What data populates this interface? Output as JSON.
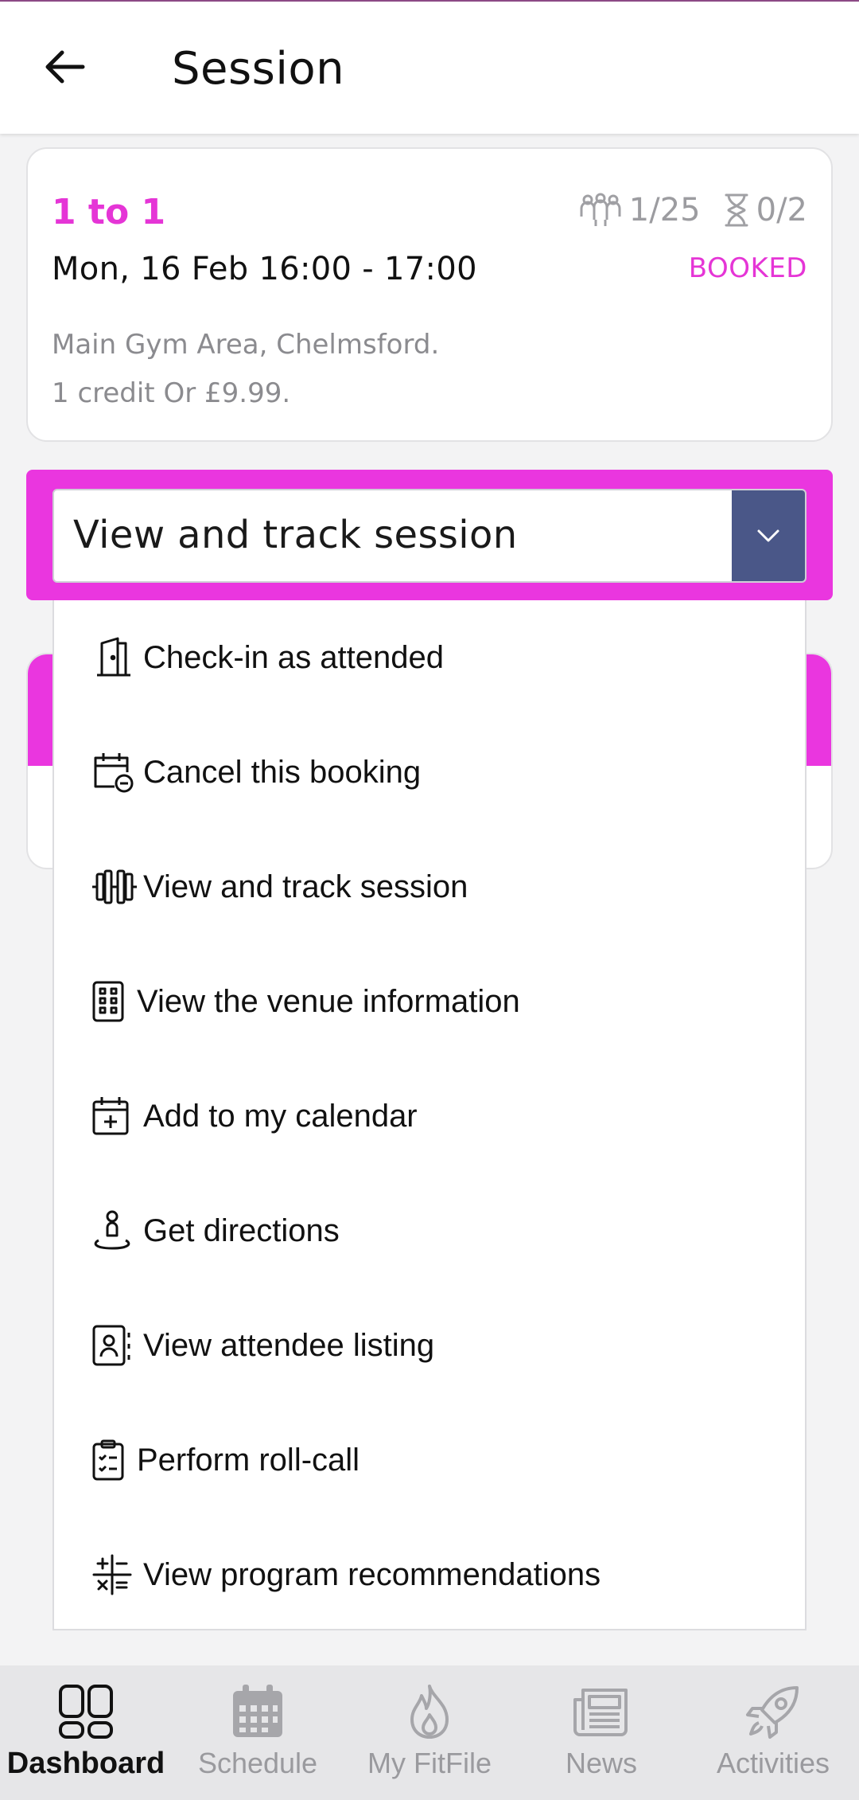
{
  "header": {
    "title": "Session"
  },
  "session": {
    "type": "1 to 1",
    "datetime": "Mon, 16 Feb 16:00 - 17:00",
    "location": "Main Gym Area, Chelmsford.",
    "price": "1 credit Or £9.99.",
    "attendees": "1/25",
    "waitlist": "0/2",
    "status": "BOOKED"
  },
  "action_select": {
    "selected": "View and track session"
  },
  "menu": {
    "items": [
      {
        "label": "Check-in as attended",
        "icon": "door-icon"
      },
      {
        "label": "Cancel this booking",
        "icon": "calendar-cancel-icon"
      },
      {
        "label": "View and track session",
        "icon": "dumbbell-icon"
      },
      {
        "label": "View the venue information",
        "icon": "building-icon"
      },
      {
        "label": "Add to my calendar",
        "icon": "calendar-add-icon"
      },
      {
        "label": "Get directions",
        "icon": "location-pin-icon"
      },
      {
        "label": "View attendee listing",
        "icon": "contact-card-icon"
      },
      {
        "label": "Perform roll-call",
        "icon": "clipboard-list-icon"
      },
      {
        "label": "View program recommendations",
        "icon": "calculator-icon"
      }
    ]
  },
  "bottom_nav": {
    "items": [
      {
        "label": "Dashboard",
        "icon": "dashboard-icon",
        "active": true
      },
      {
        "label": "Schedule",
        "icon": "calendar-icon",
        "active": false
      },
      {
        "label": "My FitFile",
        "icon": "flame-icon",
        "active": false
      },
      {
        "label": "News",
        "icon": "newspaper-icon",
        "active": false
      },
      {
        "label": "Activities",
        "icon": "rocket-icon",
        "active": false
      }
    ]
  },
  "colors": {
    "accent": "#ea36df",
    "accent_text": "#e535d6",
    "select_toggle": "#4a5788",
    "muted_text": "#8b8b8f"
  }
}
